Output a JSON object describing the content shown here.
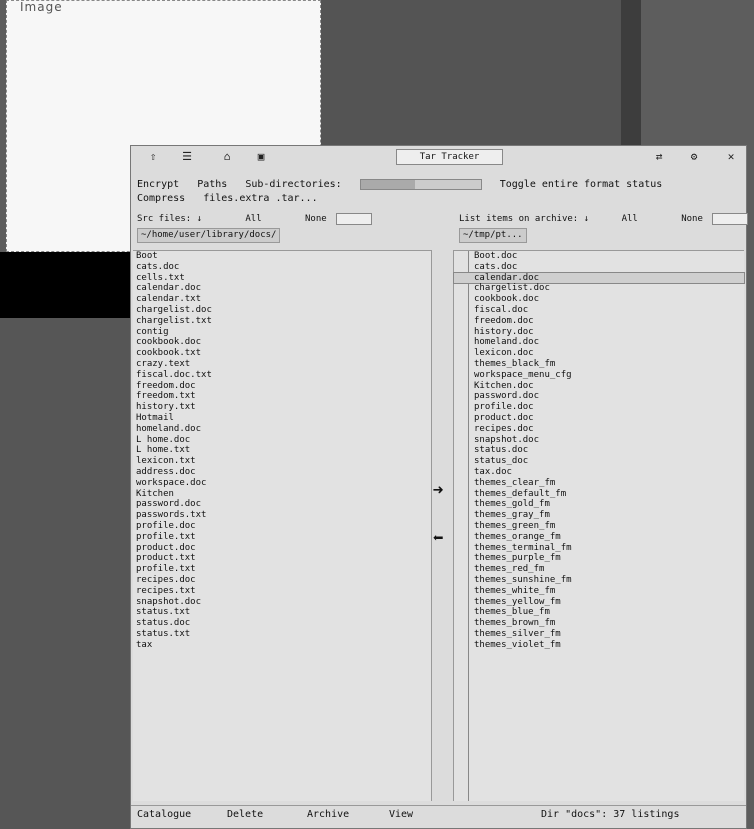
{
  "background": {
    "title": "Image"
  },
  "window": {
    "title_field": "Tar Tracker",
    "toolbar": {
      "left_icons": [
        "up-icon",
        "list-icon",
        "home-icon",
        "folder-icon"
      ],
      "right_icons": [
        "sync-icon",
        "gear-icon",
        "close-icon"
      ]
    },
    "options_row": {
      "encrypt": "Encrypt",
      "paths": "Paths",
      "subdirs": "Sub-directories:",
      "progress": 0.45,
      "toggle": "Toggle entire format status"
    },
    "compress_row": {
      "label": "Compress",
      "value": "files.extra .tar..."
    },
    "left_pane": {
      "header": "Src files: ↓",
      "all_label": "All",
      "none_label": "None",
      "path": "~/home/user/library/docs/",
      "files": [
        "Boot",
        "cats.doc",
        "cells.txt",
        "calendar.doc",
        "calendar.txt",
        "chargelist.doc",
        "chargelist.txt",
        "contig",
        "cookbook.doc",
        "cookbook.txt",
        "crazy.text",
        "fiscal.doc.txt",
        "freedom.doc",
        "freedom.txt",
        "history.txt",
        "Hotmail",
        "homeland.doc",
        "L home.doc",
        "L home.txt",
        "lexicon.txt",
        "address.doc",
        "workspace.doc",
        "Kitchen",
        "password.doc",
        "passwords.txt",
        "profile.doc",
        "profile.txt",
        "product.doc",
        "product.txt",
        "profile.txt",
        "recipes.doc",
        "recipes.txt",
        "snapshot.doc",
        "status.txt",
        "status.doc",
        "status.txt",
        "tax"
      ]
    },
    "right_pane": {
      "header": "List items on archive: ↓",
      "all_label": "All",
      "none_label": "None",
      "path": "~/tmp/pt...",
      "files": [
        "Boot.doc",
        "cats.doc",
        "calendar.doc",
        "chargelist.doc",
        "cookbook.doc",
        "fiscal.doc",
        "freedom.doc",
        "history.doc",
        "homeland.doc",
        "lexicon.doc",
        "themes_black_fm",
        "workspace_menu_cfg",
        "Kitchen.doc",
        "password.doc",
        "profile.doc",
        "product.doc",
        "recipes.doc",
        "snapshot.doc",
        "status.doc",
        "status_doc",
        "tax.doc",
        "themes_clear_fm",
        "themes_default_fm",
        "themes_gold_fm",
        "themes_gray_fm",
        "themes_green_fm",
        "themes_orange_fm",
        "themes_terminal_fm",
        "themes_purple_fm",
        "themes_red_fm",
        "themes_sunshine_fm",
        "themes_white_fm",
        "themes_yellow_fm",
        "themes_blue_fm",
        "themes_brown_fm",
        "themes_silver_fm",
        "themes_violet_fm"
      ],
      "selected_index": 2
    },
    "arrows": {
      "add": "➜",
      "remove": "⬅"
    },
    "bottom": {
      "catalogue": "Catalogue",
      "delete": "Delete",
      "archive": "Archive",
      "view": "View",
      "status": "Dir \"docs\": 37 listings"
    }
  }
}
